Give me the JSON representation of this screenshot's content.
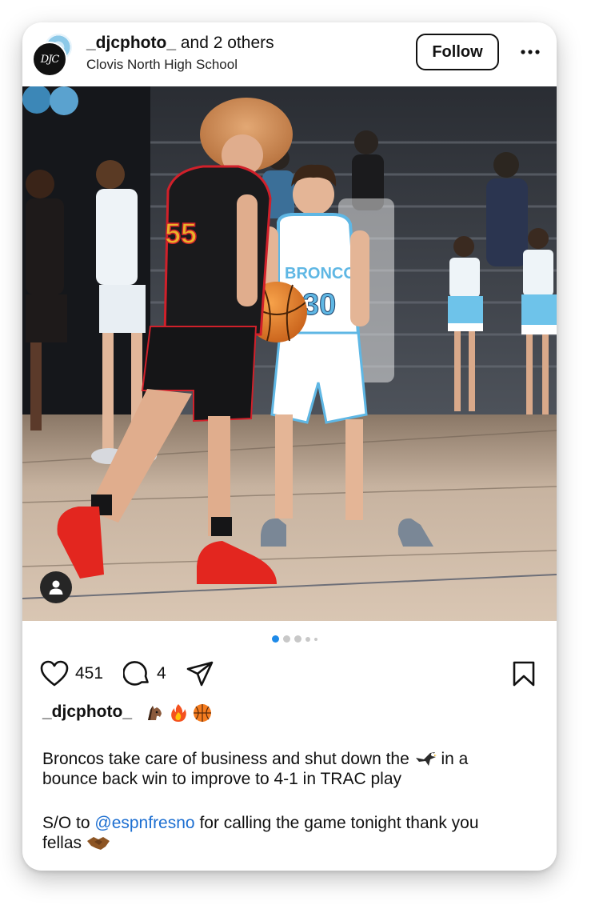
{
  "post": {
    "author": "_djcphoto_",
    "coauthors": "and 2 others",
    "location": "Clovis North High School",
    "follow_label": "Follow",
    "avatar_text": "DJC"
  },
  "photo": {
    "jersey_red": "55",
    "jersey_white_team": "BRONCOS",
    "jersey_white_number": "30"
  },
  "carousel": {
    "total_dots": 5,
    "active_index": 0
  },
  "actions": {
    "likes": "451",
    "comments": "4"
  },
  "caption": {
    "username": "_djcphoto_",
    "emojis": [
      "horse-face",
      "fire",
      "basketball"
    ],
    "line1_a": "Broncos take care of business and shut down the",
    "line1_b": "in a",
    "line2": "bounce back win to improve to 4-1 in TRAC play",
    "line3_a": "S/O to",
    "line3_mention": "@espnfresno",
    "line3_b": "for calling the game tonight thank you",
    "line4": "fellas"
  },
  "colors": {
    "accent_blue": "#1e8ae8",
    "mention_blue": "#1d6fd1",
    "broncos_blue": "#5fb7e4",
    "shoe_red": "#e01f1f"
  }
}
